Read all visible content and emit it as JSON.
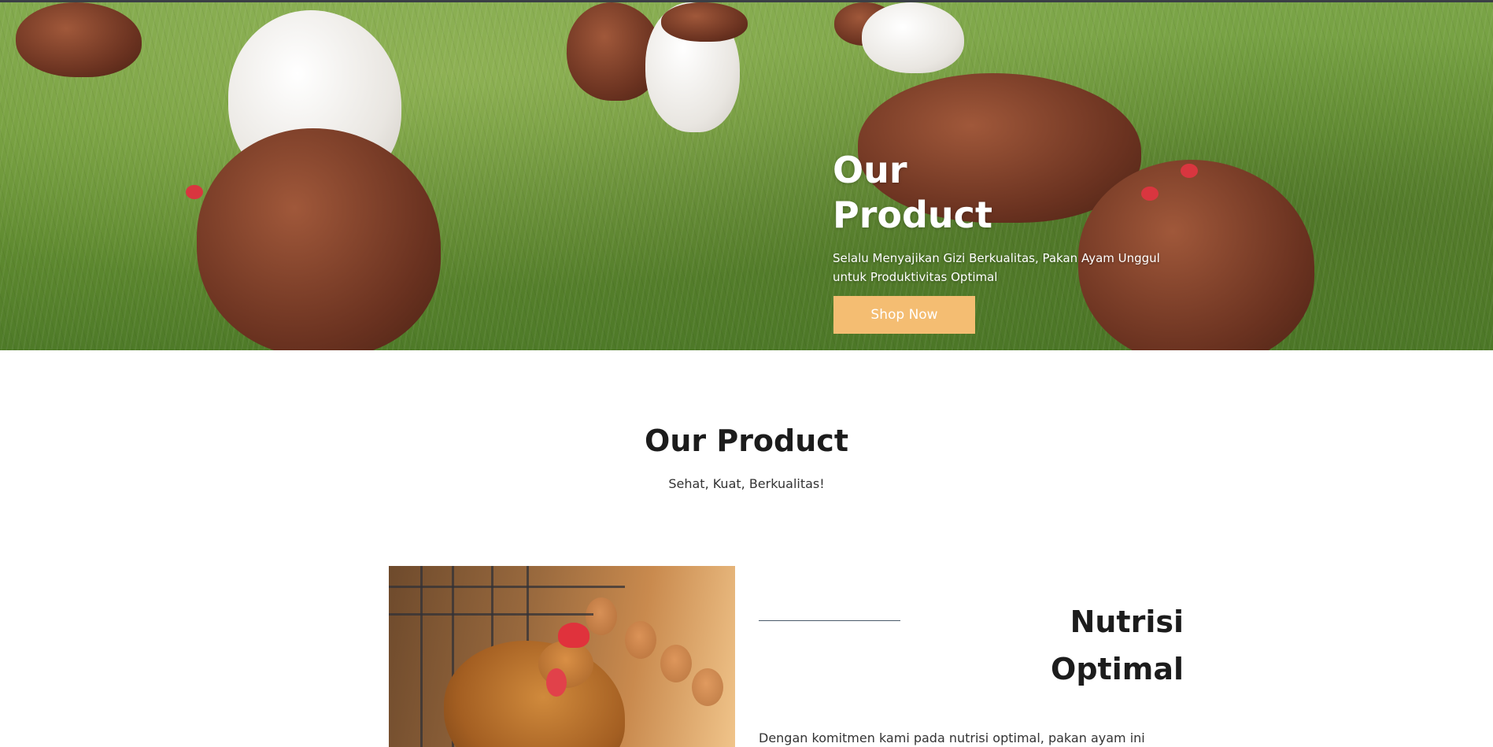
{
  "hero": {
    "title": "Our Product",
    "subtitle": "Selalu Menyajikan Gizi Berkualitas, Pakan Ayam Unggul untuk Produktivitas Optimal",
    "cta_label": "Shop Now"
  },
  "section": {
    "title": "Our Product",
    "subtitle": "Sehat, Kuat, Berkualitas!"
  },
  "product": {
    "title": "Nutrisi Optimal",
    "description": "Dengan komitmen kami pada nutrisi optimal, pakan ayam ini"
  },
  "colors": {
    "accent": "#f4bd72",
    "heading": "#1c1c1c",
    "text": "#333333"
  }
}
